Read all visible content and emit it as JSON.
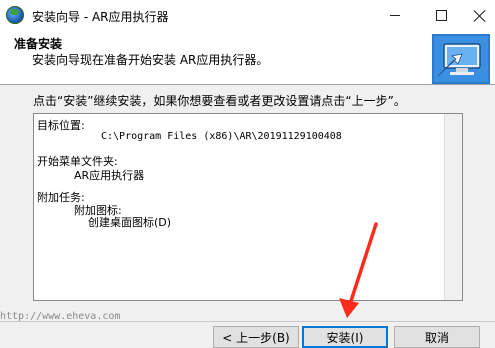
{
  "window": {
    "title": "安装向导 - AR应用执行器"
  },
  "header": {
    "title": "准备安装",
    "subtitle": "安装向导现在准备开始安装 AR应用执行器。"
  },
  "body": {
    "instruction": "点击“安装”继续安装，如果你想要查看或者更改设置请点击“上一步”。",
    "summary": {
      "target_label": "目标位置:",
      "target_value": "C:\\Program Files (x86)\\AR\\20191129100408",
      "menu_label": "开始菜单文件夹:",
      "menu_value": "AR应用执行器",
      "tasks_label": "附加任务:",
      "tasks_sub_label": "附加图标:",
      "tasks_value": "创建桌面图标(D)"
    }
  },
  "watermark": "http://www.eheva.com",
  "buttons": {
    "back": "< 上一步(B)",
    "install": "安装(I)",
    "cancel": "取消"
  },
  "colors": {
    "annotation_arrow": "#ff2a1a",
    "focus_border": "#0078d7"
  }
}
